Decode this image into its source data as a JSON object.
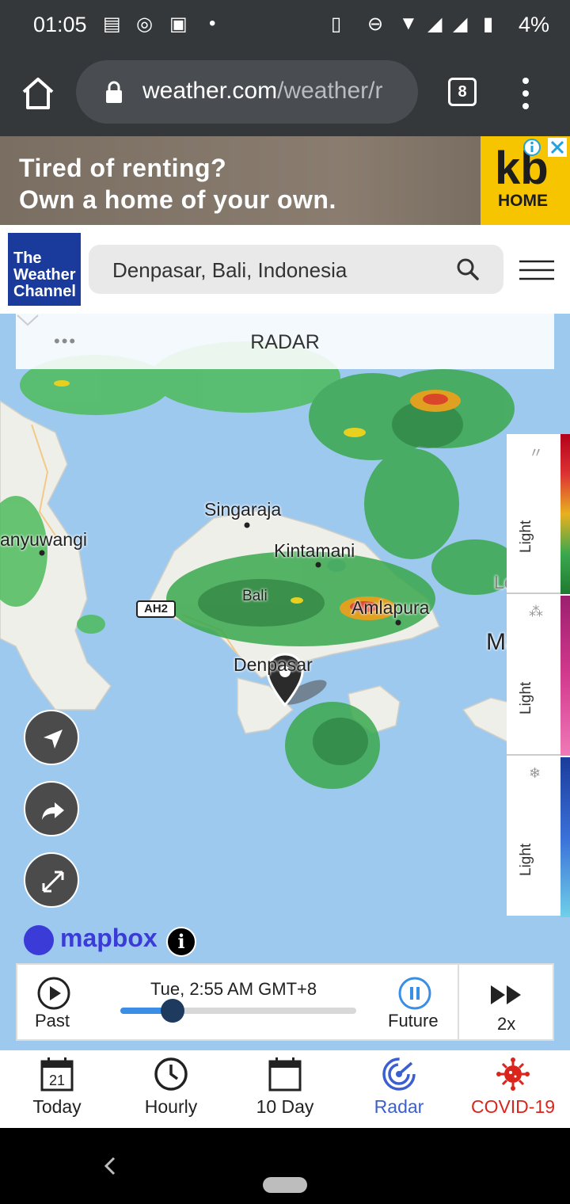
{
  "status_bar": {
    "time": "01:05",
    "battery_percent": "4%"
  },
  "browser": {
    "url_domain": "weather.com",
    "url_path": "/weather/r",
    "tab_count": "8"
  },
  "ad": {
    "line1": "Tired of renting?",
    "line2": "Own a home of your own.",
    "brand_top": "kb",
    "brand_bottom": "HOME"
  },
  "header": {
    "logo_line1": "The",
    "logo_line2": "Weather",
    "logo_line3": "Channel",
    "search_value": "Denpasar, Bali, Indonesia"
  },
  "map": {
    "title": "RADAR",
    "road_label": "AH2",
    "labels": {
      "singaraja": "Singaraja",
      "banyuwangi": "anyuwangi",
      "kintamani": "Kintamani",
      "bali": "Bali",
      "amlapura": "Amlapura",
      "denpasar": "Denpasar",
      "lombok": "Lombol",
      "mataram": "Matar"
    },
    "attribution": "mapbox",
    "info_symbol": "i"
  },
  "legend": {
    "rain_label": "Light",
    "mix_label": "Light",
    "snow_label": "Light",
    "rain_icon": "raindrop-icon",
    "mix_icon": "mix-icon",
    "snow_icon": "snowflake-icon"
  },
  "playback": {
    "past_label": "Past",
    "time_label": "Tue, 2:55 AM GMT+8",
    "future_label": "Future",
    "speed_label": "2x",
    "progress": 0.18
  },
  "bottom_nav": {
    "today_day": "21",
    "items": [
      {
        "label": "Today"
      },
      {
        "label": "Hourly"
      },
      {
        "label": "10 Day"
      },
      {
        "label": "Radar"
      },
      {
        "label": "COVID-19"
      }
    ]
  },
  "colors": {
    "active_nav": "#3b5fd0",
    "covid_nav": "#d9251c",
    "logo_blue": "#1b3b9c",
    "map_water": "#9ec9ef"
  }
}
